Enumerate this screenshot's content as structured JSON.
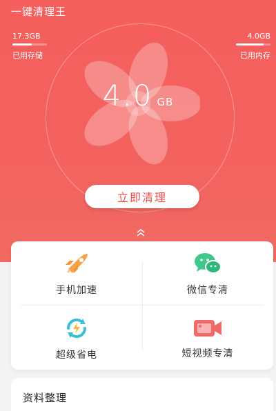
{
  "header": {
    "title": "一键清理王"
  },
  "storage": {
    "value": "17.3GB",
    "label": "已用存储",
    "level": 0.55
  },
  "memory": {
    "value": "4.0GB",
    "label": "已用内存",
    "level": 0.8
  },
  "cleanable": {
    "value": "4.0",
    "unit": "GB"
  },
  "actions": {
    "clean_label": "立即清理"
  },
  "features": [
    {
      "label": "手机加速",
      "icon": "rocket-icon"
    },
    {
      "label": "微信专清",
      "icon": "wechat-icon"
    },
    {
      "label": "超级省电",
      "icon": "power-save-icon"
    },
    {
      "label": "短视频专清",
      "icon": "video-camera-icon"
    }
  ],
  "section": {
    "title": "资料整理"
  },
  "colors": {
    "primary": "#f45e5c",
    "accent_orange": "#f7a34b",
    "accent_green": "#3ec98a",
    "accent_teal": "#3bbfd6",
    "accent_red": "#f06a6a"
  }
}
